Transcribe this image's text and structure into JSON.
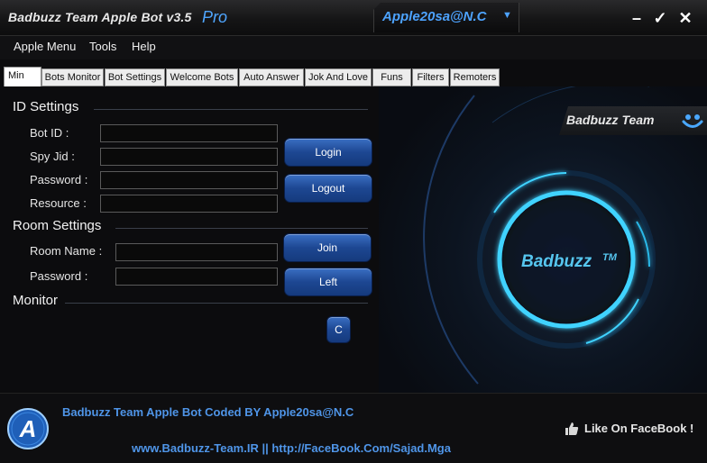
{
  "window": {
    "title": "Badbuzz Team Apple Bot  v3.5",
    "edition": "Pro",
    "account": "Apple20sa@N.C",
    "account_arrow": "▼",
    "minimize_glyph": "–",
    "ok_glyph": "✓",
    "close_glyph": "✕"
  },
  "menu": [
    "Apple Menu",
    "Tools",
    "Help"
  ],
  "tabs": [
    "Min",
    "Bots Monitor",
    "Bot Settings",
    "Welcome Bots",
    "Auto Answer",
    "Jok And Love",
    "Funs",
    "Filters",
    "Remoters"
  ],
  "id_settings": {
    "title": "ID Settings",
    "bot_id_label": "Bot ID :",
    "bot_id_value": "",
    "spy_jid_label": "Spy Jid :",
    "spy_jid_value": "",
    "password_label": "Password :",
    "password_value": "",
    "resource_label": "Resource :",
    "resource_value": "",
    "login_button": "Login",
    "logout_button": "Logout"
  },
  "room_settings": {
    "title": "Room Settings",
    "room_name_label": "Room Name :",
    "room_name_value": "",
    "password_label": "Password :",
    "password_value": "",
    "join_button": "Join",
    "left_button": "Left"
  },
  "monitor": {
    "title": "Monitor",
    "clear_button": "C"
  },
  "brand": {
    "banner": "Badbuzz Team",
    "logo": "Badbuzz",
    "trademark": "TM"
  },
  "footer": {
    "logo_letter": "A",
    "credit": "Badbuzz Team Apple Bot Coded BY Apple20sa@N.C",
    "links": "www.Badbuzz-Team.IR  || http://FaceBook.Com/Sajad.Mga",
    "like": "Like On FaceBook !"
  },
  "colors": {
    "accent_blue": "#4da3ff",
    "button_blue": "#1d4792",
    "ring_cyan": "#3fd3ff"
  },
  "icons": [
    "smiley-icon",
    "apple-a-logo-icon",
    "thumbs-up-icon",
    "chevron-down-icon",
    "minimize-icon",
    "checkmark-icon",
    "close-icon"
  ]
}
